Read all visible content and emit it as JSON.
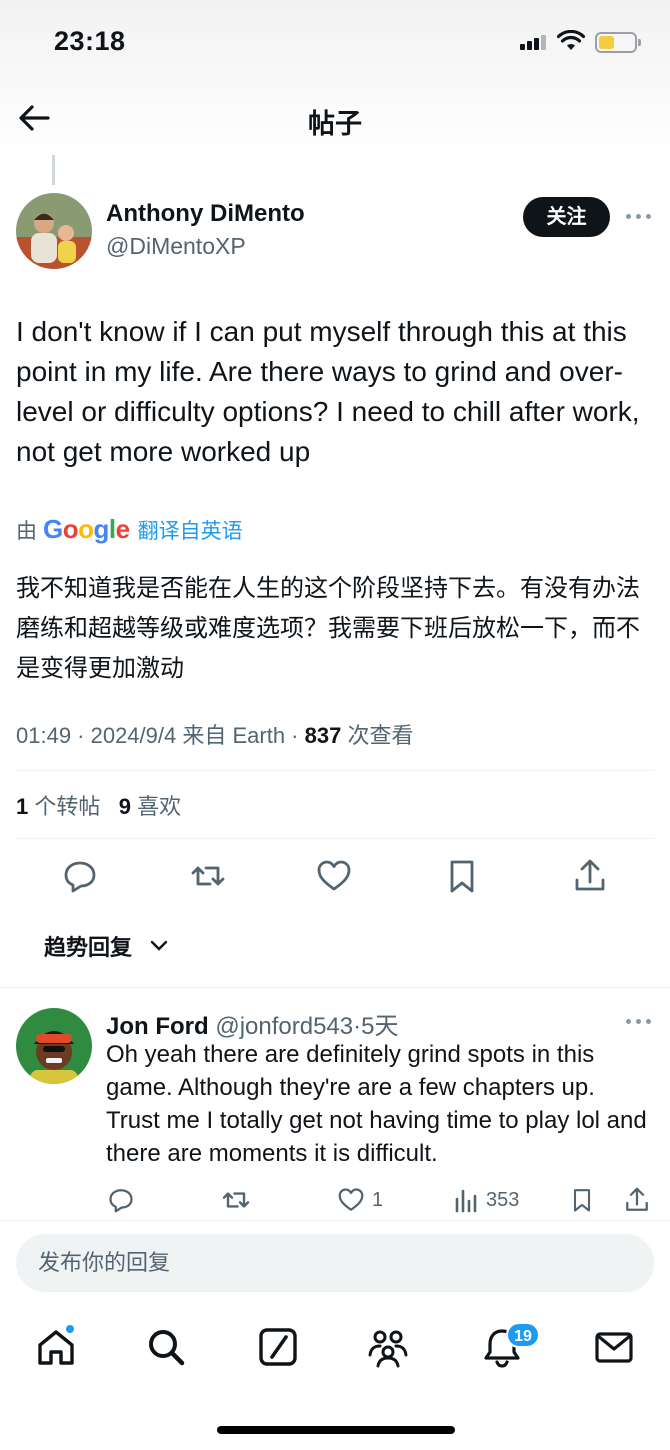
{
  "status_bar": {
    "time": "23:18"
  },
  "header": {
    "title": "帖子"
  },
  "post": {
    "author_name": "Anthony DiMento",
    "author_handle": "@DiMentoXP",
    "follow_label": "关注",
    "text": "I don't know if I can put myself through this at this point in my life. Are there ways to grind and over-level or difficulty options? I need to chill after work, not get more worked up",
    "translation_by": "由",
    "translation_brand": "Google",
    "translation_source": "翻译自英语",
    "translated_text": "我不知道我是否能在人生的这个阶段坚持下去。有没有办法磨练和超越等级或难度选项？我需要下班后放松一下，而不是变得更加激动",
    "timestamp": "01:49 · 2024/9/4 来自 Earth · ",
    "views_count": "837",
    "views_label": " 次查看",
    "reposts_count": "1",
    "reposts_label": "个转帖",
    "likes_count": "9",
    "likes_label": "喜欢"
  },
  "sort": {
    "label": "趋势回复"
  },
  "reply": {
    "author_name": "Jon Ford",
    "author_handle": "@jonford543",
    "time_ago": "·5天",
    "text": "Oh yeah there are definitely grind spots in this game. Although they're are a few chapters up. Trust me I totally get not having time to play lol and there are moments it is difficult.",
    "likes": "1",
    "views": "353"
  },
  "reply_input": {
    "placeholder": "发布你的回复"
  },
  "bottom_nav": {
    "notifications_badge": "19"
  },
  "colors": {
    "accent": "#1d9bf0",
    "text": "#0f1419",
    "secondary": "#536471"
  }
}
